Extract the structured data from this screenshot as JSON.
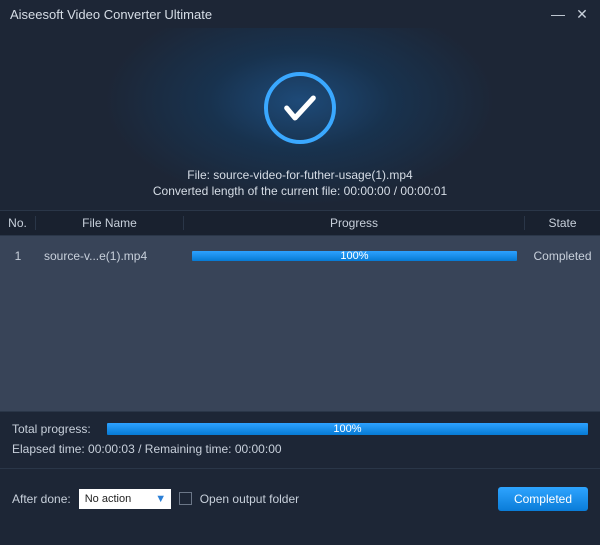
{
  "window": {
    "title": "Aiseesoft Video Converter Ultimate"
  },
  "hero": {
    "file_label": "File:",
    "file_name": "source-video-for-futher-usage(1).mp4",
    "length_label": "Converted length of the current file:",
    "length_current": "00:00:00",
    "length_total": "00:00:01"
  },
  "table": {
    "headers": {
      "no": "No.",
      "name": "File Name",
      "progress": "Progress",
      "state": "State"
    },
    "rows": [
      {
        "no": "1",
        "name": "source-v...e(1).mp4",
        "percent": "100%",
        "state": "Completed"
      }
    ]
  },
  "totals": {
    "total_label": "Total progress:",
    "total_percent": "100%",
    "elapsed_label": "Elapsed time:",
    "elapsed": "00:00:03",
    "remaining_label": "Remaining time:",
    "remaining": "00:00:00"
  },
  "footer": {
    "after_done_label": "After done:",
    "after_done_value": "No action",
    "open_folder_label": "Open output folder",
    "button": "Completed"
  }
}
